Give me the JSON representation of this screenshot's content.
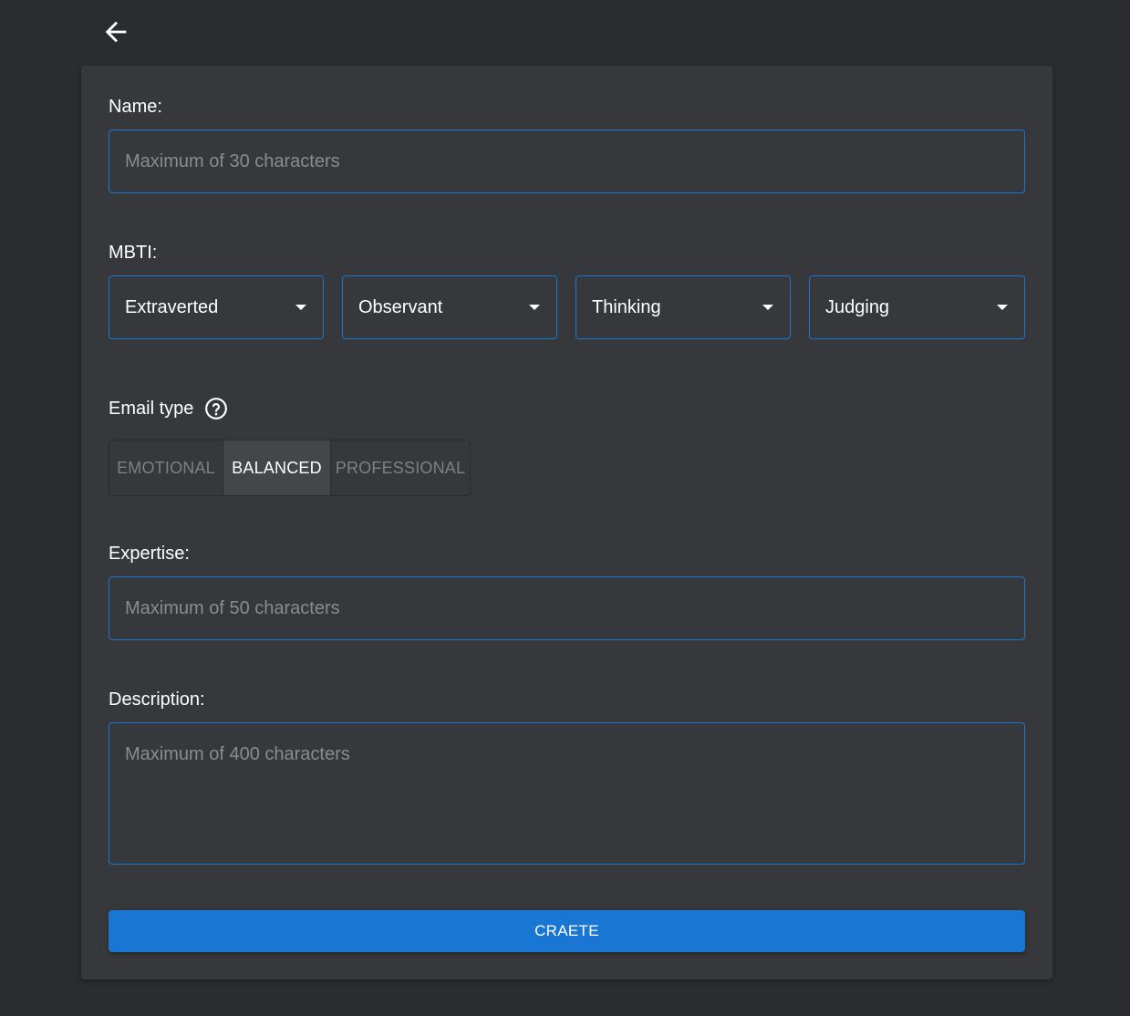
{
  "header": {
    "back_icon": "arrow-left-icon"
  },
  "form": {
    "name": {
      "label": "Name:",
      "placeholder": "Maximum of 30 characters",
      "value": ""
    },
    "mbti": {
      "label": "MBTI:",
      "selects": [
        {
          "value": "Extraverted"
        },
        {
          "value": "Observant"
        },
        {
          "value": "Thinking"
        },
        {
          "value": "Judging"
        }
      ]
    },
    "email_type": {
      "label": "Email type",
      "help_icon": "question-circle-icon",
      "options": [
        "EMOTIONAL",
        "BALANCED",
        "PROFESSIONAL"
      ],
      "selected": "BALANCED"
    },
    "expertise": {
      "label": "Expertise:",
      "placeholder": "Maximum of 50 characters",
      "value": ""
    },
    "description": {
      "label": "Description:",
      "placeholder": "Maximum of 400 characters",
      "value": ""
    },
    "submit_label": "CRAETE"
  },
  "colors": {
    "background": "#2b2c2f",
    "card": "#37383b",
    "accent": "#1976d2",
    "toggle_active": "#45464a"
  }
}
